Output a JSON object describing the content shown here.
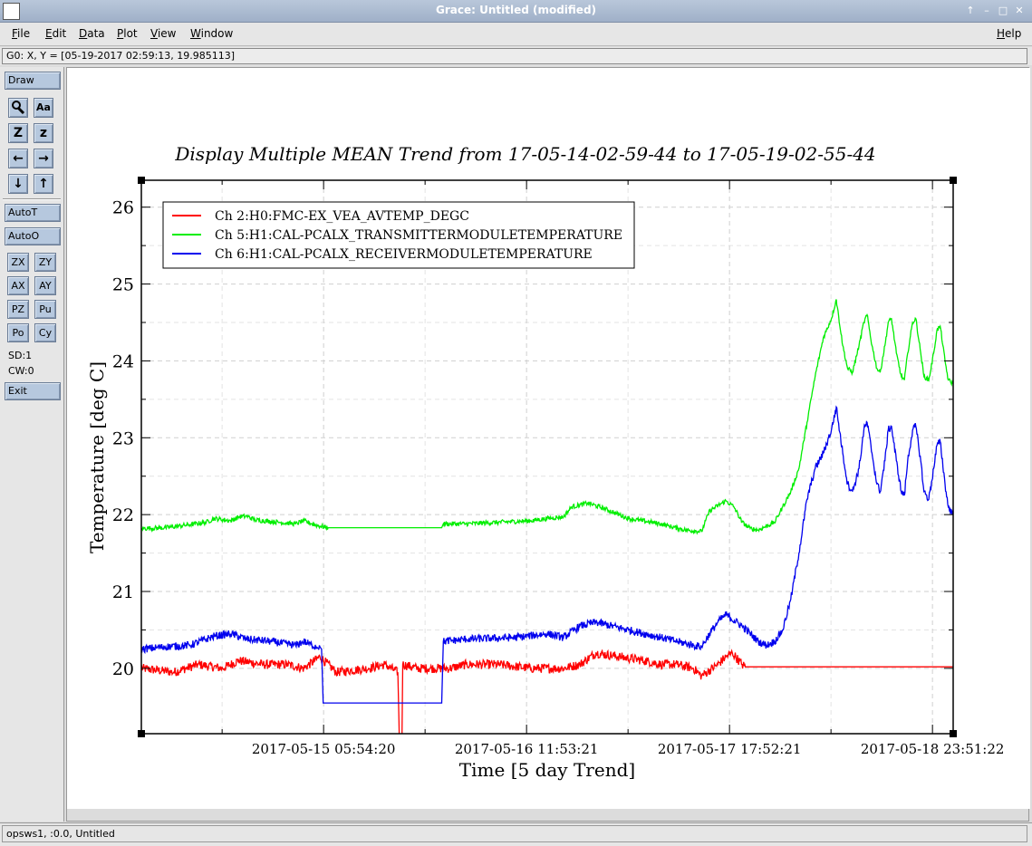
{
  "window": {
    "title": "Grace: Untitled (modified)",
    "controls": [
      "↑",
      "–",
      "□",
      "✕"
    ]
  },
  "menu": {
    "items": [
      {
        "label": "File",
        "u": "F",
        "rest": "ile"
      },
      {
        "label": "Edit",
        "u": "E",
        "rest": "dit"
      },
      {
        "label": "Data",
        "u": "D",
        "rest": "ata"
      },
      {
        "label": "Plot",
        "u": "P",
        "rest": "lot"
      },
      {
        "label": "View",
        "u": "V",
        "rest": "iew"
      },
      {
        "label": "Window",
        "u": "W",
        "rest": "indow"
      }
    ],
    "help": {
      "label": "Help",
      "u": "H",
      "rest": "elp"
    }
  },
  "locator": {
    "text": "G0: X, Y = [05-19-2017 02:59:13, 19.985113]"
  },
  "toolbar": {
    "draw": "Draw",
    "autot": "AutoT",
    "autoo": "AutoO",
    "exit": "Exit",
    "icon_buttons": [
      {
        "name": "zoom-magnifier-icon",
        "glyph": "🔍"
      },
      {
        "name": "text-label-icon",
        "glyph": "Aa"
      },
      {
        "name": "zoom-x-icon",
        "glyph": "Z"
      },
      {
        "name": "zoom-y-icon",
        "glyph": "z"
      },
      {
        "name": "scroll-left-icon",
        "glyph": "←"
      },
      {
        "name": "scroll-right-icon",
        "glyph": "→"
      },
      {
        "name": "scroll-down-icon",
        "glyph": "↓"
      },
      {
        "name": "scroll-up-icon",
        "glyph": "↑"
      }
    ],
    "small_buttons": [
      "ZX",
      "ZY",
      "AX",
      "AY",
      "PZ",
      "Pu",
      "Po",
      "Cy"
    ],
    "sd": "SD:1",
    "cw": "CW:0"
  },
  "status": {
    "text": "opsws1, :0.0, Untitled"
  },
  "chart_data": {
    "type": "line",
    "title": "Display Multiple MEAN Trend from 17-05-14-02-59-44 to 17-05-19-02-55-44",
    "xlabel": "Time [5 day Trend]",
    "ylabel": "Temperature [deg C]",
    "x_unit": "days since 2017-05-14 02:59:44",
    "xlim": [
      0,
      5
    ],
    "ylim": [
      19.15,
      26.35
    ],
    "yticks": [
      20,
      21,
      22,
      23,
      24,
      25,
      26
    ],
    "xticks": [
      {
        "x": 1.1225,
        "label": "2017-05-15 05:54:20"
      },
      {
        "x": 2.3725,
        "label": "2017-05-16 11:53:21"
      },
      {
        "x": 3.6225,
        "label": "2017-05-17 17:52:21"
      },
      {
        "x": 4.8725,
        "label": "2017-05-18 23:51:22"
      }
    ],
    "grid": true,
    "legend": "top-left",
    "series": [
      {
        "name": "Ch 2:H0:FMC-EX_VEA_AVTEMP_DEGC",
        "color": "#ff0000",
        "noise": 0.06,
        "points": [
          [
            0,
            20.0
          ],
          [
            0.2,
            19.95
          ],
          [
            0.35,
            20.05
          ],
          [
            0.5,
            20.0
          ],
          [
            0.6,
            20.1
          ],
          [
            0.75,
            20.05
          ],
          [
            0.9,
            20.05
          ],
          [
            1.0,
            20.0
          ],
          [
            1.1,
            20.15
          ],
          [
            1.2,
            19.95
          ],
          [
            1.4,
            20.0
          ],
          [
            1.5,
            20.05
          ],
          [
            1.58,
            19.95
          ],
          [
            1.6,
            18.0
          ],
          [
            1.61,
            20.05
          ],
          [
            1.7,
            20.0
          ],
          [
            1.9,
            20.0
          ],
          [
            2.0,
            20.05
          ],
          [
            2.2,
            20.05
          ],
          [
            2.4,
            20.0
          ],
          [
            2.6,
            20.0
          ],
          [
            2.7,
            20.05
          ],
          [
            2.8,
            20.2
          ],
          [
            2.95,
            20.15
          ],
          [
            3.1,
            20.1
          ],
          [
            3.2,
            20.05
          ],
          [
            3.3,
            20.05
          ],
          [
            3.4,
            20.0
          ],
          [
            3.45,
            19.9
          ],
          [
            3.55,
            20.05
          ],
          [
            3.6,
            20.15
          ],
          [
            3.64,
            20.2
          ],
          [
            3.7,
            20.05
          ],
          [
            3.72,
            20.02
          ],
          [
            5.0,
            20.02
          ]
        ]
      },
      {
        "name": "Ch 5:H1:CAL-PCALX_TRANSMITTERMODULETEMPERATURE",
        "color": "#00ee00",
        "noise": 0.03,
        "points": [
          [
            0,
            21.82
          ],
          [
            0.15,
            21.83
          ],
          [
            0.3,
            21.87
          ],
          [
            0.4,
            21.9
          ],
          [
            0.45,
            21.95
          ],
          [
            0.55,
            21.92
          ],
          [
            0.6,
            21.97
          ],
          [
            0.65,
            21.98
          ],
          [
            0.7,
            21.93
          ],
          [
            0.85,
            21.9
          ],
          [
            0.95,
            21.88
          ],
          [
            1.0,
            21.92
          ],
          [
            1.05,
            21.88
          ],
          [
            1.1,
            21.85
          ],
          [
            1.15,
            21.83
          ],
          [
            1.16,
            21.83
          ],
          [
            1.85,
            21.83
          ],
          [
            1.86,
            21.88
          ],
          [
            2.0,
            21.88
          ],
          [
            2.2,
            21.9
          ],
          [
            2.4,
            21.92
          ],
          [
            2.5,
            21.95
          ],
          [
            2.6,
            21.97
          ],
          [
            2.65,
            22.1
          ],
          [
            2.75,
            22.15
          ],
          [
            2.85,
            22.08
          ],
          [
            3.0,
            21.95
          ],
          [
            3.2,
            21.88
          ],
          [
            3.25,
            21.85
          ],
          [
            3.35,
            21.8
          ],
          [
            3.45,
            21.78
          ],
          [
            3.5,
            22.05
          ],
          [
            3.6,
            22.18
          ],
          [
            3.65,
            22.1
          ],
          [
            3.7,
            21.9
          ],
          [
            3.75,
            21.82
          ],
          [
            3.8,
            21.8
          ],
          [
            3.9,
            21.9
          ],
          [
            3.95,
            22.1
          ],
          [
            4.0,
            22.3
          ],
          [
            4.05,
            22.6
          ],
          [
            4.1,
            23.2
          ],
          [
            4.15,
            23.8
          ],
          [
            4.2,
            24.3
          ],
          [
            4.25,
            24.55
          ],
          [
            4.28,
            24.8
          ],
          [
            4.32,
            24.2
          ],
          [
            4.35,
            23.9
          ],
          [
            4.38,
            23.85
          ],
          [
            4.42,
            24.2
          ],
          [
            4.45,
            24.5
          ],
          [
            4.47,
            24.6
          ],
          [
            4.5,
            24.2
          ],
          [
            4.53,
            23.9
          ],
          [
            4.55,
            23.85
          ],
          [
            4.58,
            24.2
          ],
          [
            4.6,
            24.5
          ],
          [
            4.62,
            24.55
          ],
          [
            4.65,
            24.1
          ],
          [
            4.68,
            23.8
          ],
          [
            4.7,
            23.75
          ],
          [
            4.72,
            24.1
          ],
          [
            4.75,
            24.5
          ],
          [
            4.77,
            24.55
          ],
          [
            4.8,
            24.1
          ],
          [
            4.82,
            23.8
          ],
          [
            4.85,
            23.75
          ],
          [
            4.88,
            24.1
          ],
          [
            4.9,
            24.4
          ],
          [
            4.92,
            24.45
          ],
          [
            4.95,
            24.0
          ],
          [
            4.97,
            23.75
          ],
          [
            5.0,
            23.7
          ]
        ]
      },
      {
        "name": "Ch 6:H1:CAL-PCALX_RECEIVERMODULETEMPERATURE",
        "color": "#0000ee",
        "noise": 0.05,
        "points": [
          [
            0,
            20.25
          ],
          [
            0.15,
            20.28
          ],
          [
            0.3,
            20.3
          ],
          [
            0.45,
            20.42
          ],
          [
            0.55,
            20.45
          ],
          [
            0.65,
            20.38
          ],
          [
            0.8,
            20.35
          ],
          [
            0.95,
            20.3
          ],
          [
            1.0,
            20.35
          ],
          [
            1.05,
            20.3
          ],
          [
            1.1,
            20.28
          ],
          [
            1.11,
            20.25
          ],
          [
            1.12,
            19.55
          ],
          [
            1.85,
            19.55
          ],
          [
            1.86,
            20.35
          ],
          [
            2.0,
            20.38
          ],
          [
            2.3,
            20.4
          ],
          [
            2.5,
            20.45
          ],
          [
            2.6,
            20.4
          ],
          [
            2.7,
            20.55
          ],
          [
            2.8,
            20.6
          ],
          [
            3.0,
            20.5
          ],
          [
            3.2,
            20.4
          ],
          [
            3.3,
            20.35
          ],
          [
            3.4,
            20.3
          ],
          [
            3.45,
            20.28
          ],
          [
            3.5,
            20.45
          ],
          [
            3.55,
            20.6
          ],
          [
            3.6,
            20.7
          ],
          [
            3.7,
            20.55
          ],
          [
            3.8,
            20.35
          ],
          [
            3.85,
            20.3
          ],
          [
            3.9,
            20.35
          ],
          [
            3.95,
            20.5
          ],
          [
            4.0,
            20.9
          ],
          [
            4.05,
            21.5
          ],
          [
            4.1,
            22.2
          ],
          [
            4.15,
            22.6
          ],
          [
            4.2,
            22.8
          ],
          [
            4.25,
            23.1
          ],
          [
            4.28,
            23.4
          ],
          [
            4.32,
            22.8
          ],
          [
            4.35,
            22.4
          ],
          [
            4.38,
            22.3
          ],
          [
            4.42,
            22.6
          ],
          [
            4.45,
            23.1
          ],
          [
            4.47,
            23.2
          ],
          [
            4.5,
            22.8
          ],
          [
            4.53,
            22.4
          ],
          [
            4.55,
            22.3
          ],
          [
            4.58,
            22.7
          ],
          [
            4.6,
            23.1
          ],
          [
            4.62,
            23.15
          ],
          [
            4.65,
            22.7
          ],
          [
            4.68,
            22.3
          ],
          [
            4.7,
            22.25
          ],
          [
            4.72,
            22.7
          ],
          [
            4.75,
            23.1
          ],
          [
            4.77,
            23.15
          ],
          [
            4.8,
            22.7
          ],
          [
            4.82,
            22.3
          ],
          [
            4.85,
            22.2
          ],
          [
            4.88,
            22.6
          ],
          [
            4.9,
            22.9
          ],
          [
            4.92,
            22.95
          ],
          [
            4.95,
            22.4
          ],
          [
            4.97,
            22.1
          ],
          [
            5.0,
            22.0
          ]
        ]
      }
    ]
  }
}
